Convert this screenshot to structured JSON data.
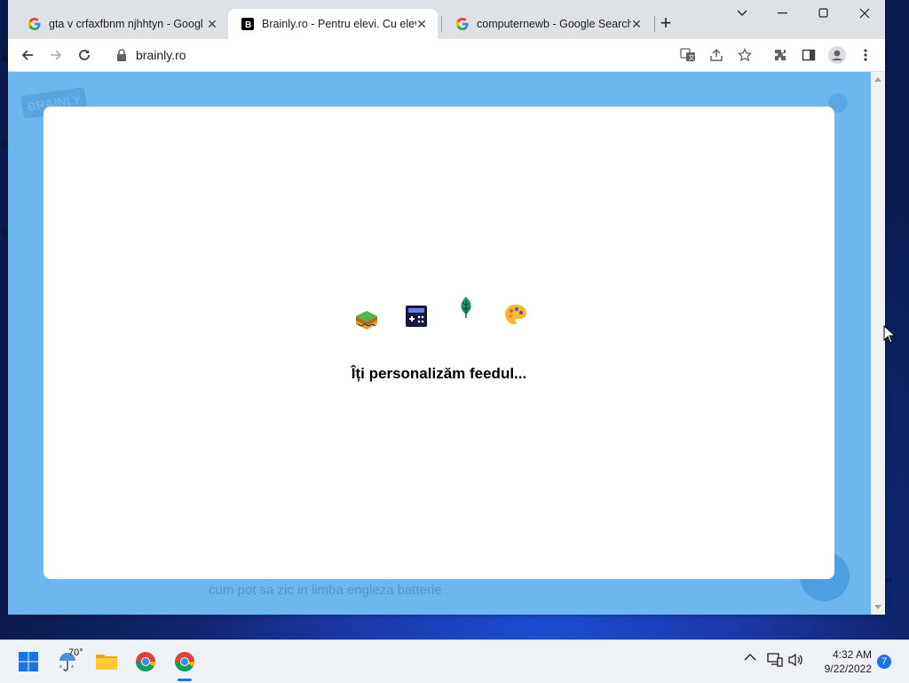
{
  "desktop": {
    "edge_letters": [
      "M",
      "D",
      "M",
      "n"
    ]
  },
  "browser": {
    "tabs": [
      {
        "title": "gta v crfaxfbnm njhhtyn - Google Search",
        "favicon": "google-g-icon",
        "active": false
      },
      {
        "title": "Brainly.ro - Pentru elevi. Cu elevi.",
        "favicon": "brainly-b-icon",
        "active": true
      },
      {
        "title": "computernewb - Google Search",
        "favicon": "google-g-icon",
        "active": false
      }
    ],
    "new_tab_label": "+",
    "address": {
      "url": "brainly.ro"
    }
  },
  "page": {
    "bg_logo": "BRAINLY",
    "bg_search_text": "cum pot sa zic in limba engleza batterie",
    "modal": {
      "message": "Îți personalizăm feedul...",
      "subject_icons": [
        "geography-layers-icon",
        "calculator-icon",
        "leaf-icon",
        "palette-icon"
      ]
    }
  },
  "taskbar": {
    "weather_temp": "70°",
    "apps": [
      "start-icon",
      "weather-icon",
      "file-explorer-icon",
      "chrome-icon",
      "chrome-active-icon"
    ],
    "clock": {
      "time": "4:32 AM",
      "date": "9/22/2022"
    },
    "notification_count": "7"
  }
}
